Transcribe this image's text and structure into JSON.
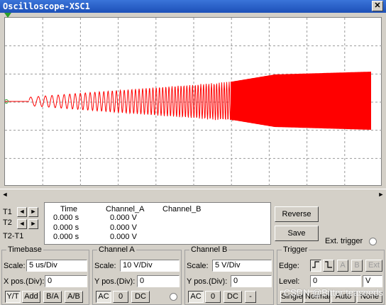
{
  "window": {
    "title": "Oscilloscope-XSC1",
    "close": "✕"
  },
  "trace": {
    "color": "#ff0000"
  },
  "cursors": {
    "t1": "T1",
    "t2": "T2",
    "t2t1": "T2-T1"
  },
  "readout": {
    "headers": [
      "Time",
      "Channel_A",
      "Channel_B"
    ],
    "rows": [
      [
        "0.000 s",
        "0.000 V",
        ""
      ],
      [
        "0.000 s",
        "0.000 V",
        ""
      ],
      [
        "0.000 s",
        "0.000 V",
        ""
      ]
    ]
  },
  "buttons": {
    "reverse": "Reverse",
    "save": "Save",
    "ext_trigger": "Ext. trigger"
  },
  "timebase": {
    "title": "Timebase",
    "scale_label": "Scale:",
    "scale_value": "5 us/Div",
    "xpos_label": "X pos.(Div):",
    "xpos_value": "0",
    "modes": [
      "Y/T",
      "Add",
      "B/A",
      "A/B"
    ]
  },
  "channel_a": {
    "title": "Channel A",
    "scale_label": "Scale:",
    "scale_value": "10  V/Div",
    "ypos_label": "Y pos.(Div):",
    "ypos_value": "0",
    "coupling": [
      "AC",
      "0",
      "DC"
    ]
  },
  "channel_b": {
    "title": "Channel B",
    "scale_label": "Scale:",
    "scale_value": "5  V/Div",
    "ypos_label": "Y pos.(Div):",
    "ypos_value": "0",
    "coupling": [
      "AC",
      "0",
      "DC",
      "-"
    ]
  },
  "trigger": {
    "title": "Trigger",
    "edge_label": "Edge:",
    "edge_buttons": [
      "A",
      "B",
      "Ext"
    ],
    "level_label": "Level:",
    "level_value": "0",
    "level_unit": "V",
    "modes": [
      "Single",
      "Normal",
      "Auto",
      "None"
    ]
  },
  "watermark": "CSDN @Bitter teaseeds"
}
